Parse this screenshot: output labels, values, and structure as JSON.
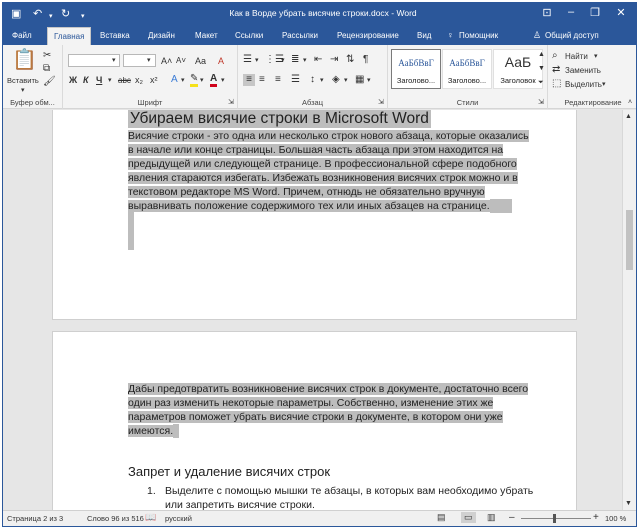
{
  "colors": {
    "accent": "#2b579a",
    "ribbon_bg": "#f3f3f3",
    "canvas_bg": "#e6e6e6",
    "selection": "#bdbdbd"
  },
  "window": {
    "title": "Как в Ворде убрать висячие строки.docx - Word",
    "quick_access": [
      "save-icon",
      "undo-icon",
      "redo-icon"
    ]
  },
  "tabs": [
    {
      "label": "Файл"
    },
    {
      "label": "Главная"
    },
    {
      "label": "Вставка"
    },
    {
      "label": "Дизайн"
    },
    {
      "label": "Макет"
    },
    {
      "label": "Ссылки"
    },
    {
      "label": "Рассылки"
    },
    {
      "label": "Рецензирование"
    },
    {
      "label": "Вид"
    },
    {
      "label": "Помощник"
    },
    {
      "label": "Общий доступ"
    }
  ],
  "ribbon": {
    "paste_label": "Вставить",
    "clipboard_group": "Буфер обм...",
    "font_group": "Шрифт",
    "paragraph_group": "Абзац",
    "styles_group": "Стили",
    "editing_group": "Редактирование",
    "font_buttons": {
      "bold": "Ж",
      "italic": "К",
      "underline": "Ч",
      "strike": "abc",
      "subscript": "x₂",
      "superscript": "x²",
      "grow": "A˄",
      "shrink": "A˅",
      "case": "Aa",
      "clear": "A"
    },
    "styles": [
      {
        "sample": "АаБбВвГ",
        "name": "Заголово..."
      },
      {
        "sample": "АаБбВвГ",
        "name": "Заголово..."
      },
      {
        "sample": "АаБ",
        "name": "Заголовок"
      }
    ],
    "editing": {
      "find": "Найти",
      "replace": "Заменить",
      "select": "Выделить"
    }
  },
  "document": {
    "page1": {
      "heading": "Убираем висячие строки в Microsoft Word",
      "lines": [
        "Висячие строки - это одна или несколько строк нового абзаца, которые оказались",
        "в начале или конце страницы. Большая часть абзаца при этом находится на",
        "предыдущей или следующей странице. В профессиональной сфере подобного",
        "явления стараются избегать. Избежать возникновения висячих строк можно и в",
        "текстовом редакторе MS Word. Причем, отнюдь не обязательно вручную",
        "выравнивать положение содержимого тех или иных абзацев на странице."
      ]
    },
    "page2": {
      "lines": [
        "Дабы предотвратить возникновение висячих строк в документе, достаточно всего",
        "один раз изменить некоторые параметры. Собственно, изменение этих же",
        "параметров поможет убрать висячие строки в документе, в котором они уже",
        "имеются."
      ],
      "subheading": "Запрет и удаление висячих строк",
      "list_number": "1.",
      "list_lines": [
        "Выделите с помощью мышки те абзацы, в которых вам необходимо убрать",
        "или запретить висячие строки."
      ]
    }
  },
  "status": {
    "page": "Страница 2 из 3",
    "words": "Слово 96 из 516",
    "language": "русский",
    "zoom": "100 %"
  }
}
